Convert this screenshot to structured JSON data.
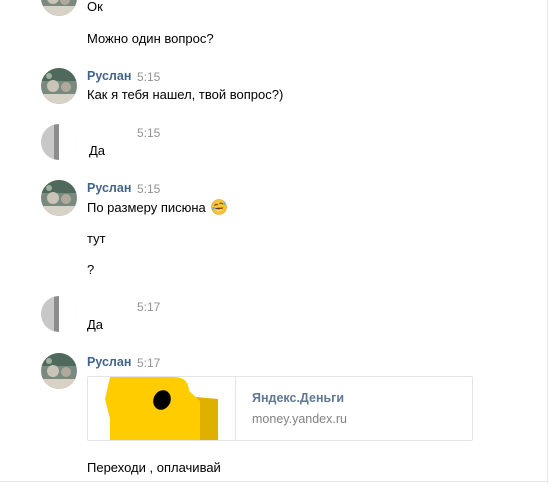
{
  "messages": [
    {
      "text": "Ок"
    },
    {
      "text": "Можно один вопрос?"
    },
    {
      "sender": "Руслан",
      "time": "5:15",
      "text": "Как я тебя нашел, твой вопрос?)"
    },
    {
      "sender": "",
      "time": "5:15",
      "text": "Да"
    },
    {
      "sender": "Руслан",
      "time": "5:15",
      "text": "По размеру писюна",
      "emoji": "rolling-on-floor-laughing-emoji"
    },
    {
      "text": "тут"
    },
    {
      "text": "?"
    },
    {
      "sender": "",
      "time": "5:17",
      "text": "Да"
    },
    {
      "sender": "Руслан",
      "time": "5:17"
    },
    {
      "text": "Переходи , оплачивай"
    }
  ],
  "link_card": {
    "title": "Яндекс.Деньги",
    "url": "money.yandex.ru",
    "logo": "yandex-money-logo"
  },
  "colors": {
    "sender_name": "#42648b",
    "timestamp": "#939393",
    "card_title": "#5f7893",
    "card_url": "#828282",
    "logo_yellow": "#ffcc00",
    "logo_dark_yellow": "#e0b000"
  }
}
